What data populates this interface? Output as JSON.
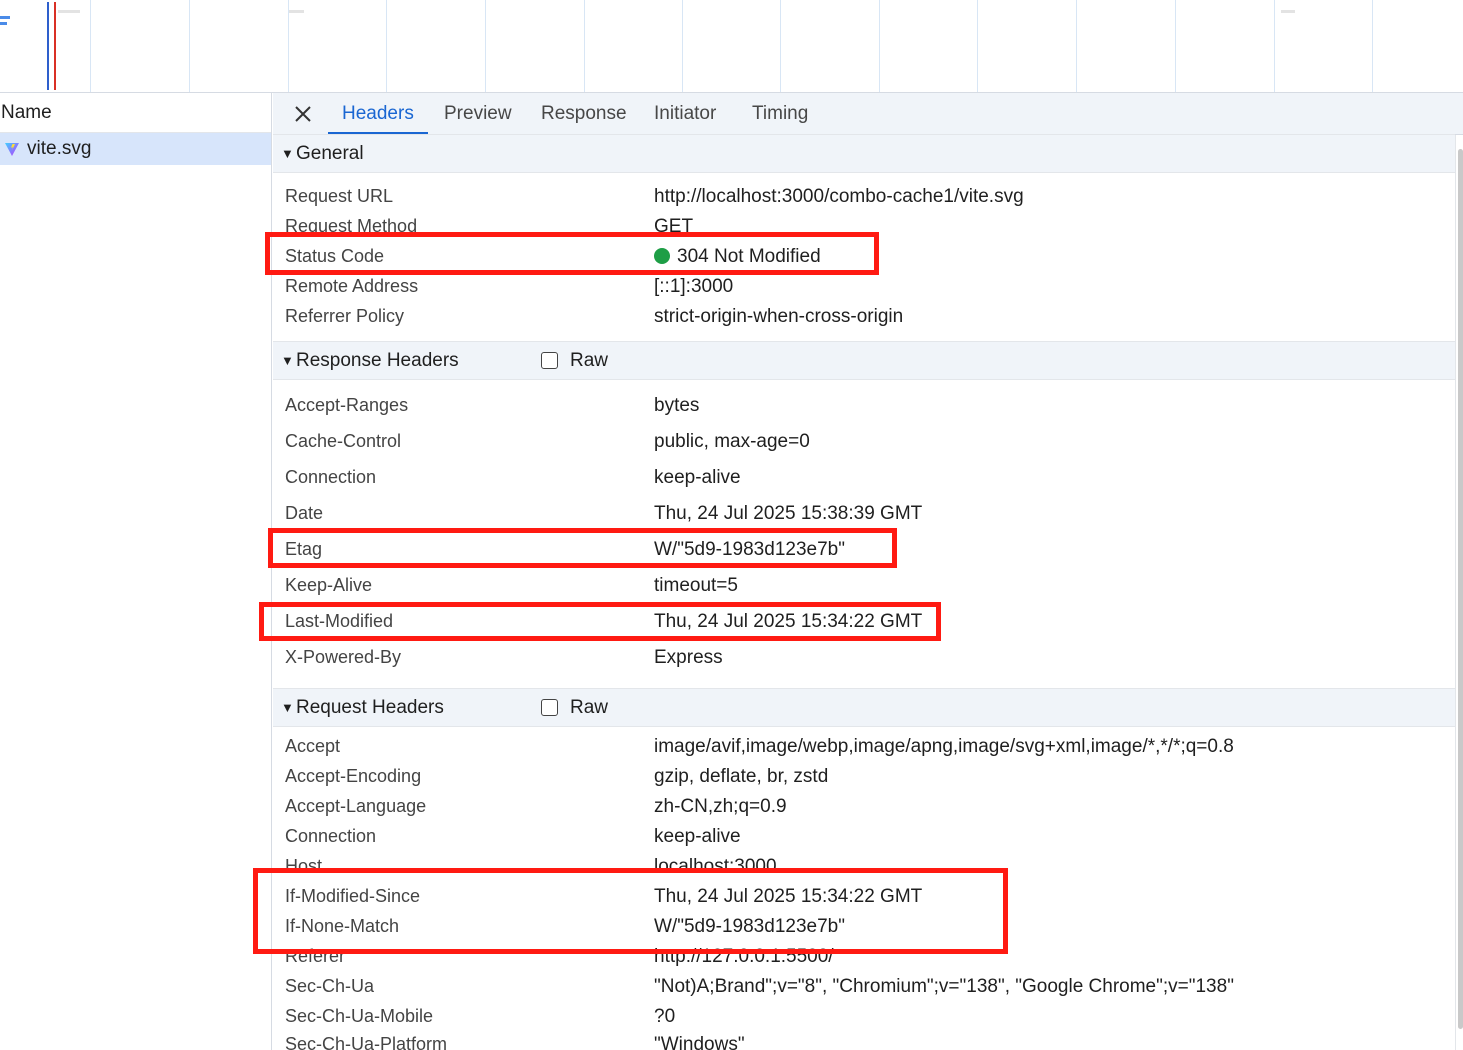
{
  "name_panel": {
    "header": "Name",
    "selected_file": "vite.svg"
  },
  "tabs": {
    "headers": "Headers",
    "preview": "Preview",
    "response": "Response",
    "initiator": "Initiator",
    "timing": "Timing"
  },
  "general": {
    "title": "General",
    "rows": [
      {
        "key": "Request URL",
        "value": "http://localhost:3000/combo-cache1/vite.svg"
      },
      {
        "key": "Request Method",
        "value": "GET"
      },
      {
        "key": "Status Code",
        "value": "304 Not Modified"
      },
      {
        "key": "Remote Address",
        "value": "[::1]:3000"
      },
      {
        "key": "Referrer Policy",
        "value": "strict-origin-when-cross-origin"
      }
    ]
  },
  "response_headers": {
    "title": "Response Headers",
    "raw_label": "Raw",
    "rows": [
      {
        "key": "Accept-Ranges",
        "value": "bytes"
      },
      {
        "key": "Cache-Control",
        "value": "public, max-age=0"
      },
      {
        "key": "Connection",
        "value": "keep-alive"
      },
      {
        "key": "Date",
        "value": "Thu, 24 Jul 2025 15:38:39 GMT"
      },
      {
        "key": "Etag",
        "value": "W/\"5d9-1983d123e7b\""
      },
      {
        "key": "Keep-Alive",
        "value": "timeout=5"
      },
      {
        "key": "Last-Modified",
        "value": "Thu, 24 Jul 2025 15:34:22 GMT"
      },
      {
        "key": "X-Powered-By",
        "value": "Express"
      }
    ]
  },
  "request_headers": {
    "title": "Request Headers",
    "raw_label": "Raw",
    "rows": [
      {
        "key": "Accept",
        "value": "image/avif,image/webp,image/apng,image/svg+xml,image/*,*/*;q=0.8"
      },
      {
        "key": "Accept-Encoding",
        "value": "gzip, deflate, br, zstd"
      },
      {
        "key": "Accept-Language",
        "value": "zh-CN,zh;q=0.9"
      },
      {
        "key": "Connection",
        "value": "keep-alive"
      },
      {
        "key": "Host",
        "value": "localhost:3000"
      },
      {
        "key": "If-Modified-Since",
        "value": "Thu, 24 Jul 2025 15:34:22 GMT"
      },
      {
        "key": "If-None-Match",
        "value": "W/\"5d9-1983d123e7b\""
      },
      {
        "key": "Referer",
        "value": "http://127.0.0.1:5500/"
      },
      {
        "key": "Sec-Ch-Ua",
        "value": "\"Not)A;Brand\";v=\"8\", \"Chromium\";v=\"138\", \"Google Chrome\";v=\"138\""
      },
      {
        "key": "Sec-Ch-Ua-Mobile",
        "value": "?0"
      },
      {
        "key": "Sec-Ch-Ua-Platform",
        "value": "\"Windows\""
      }
    ]
  },
  "colors": {
    "accent": "#1a66d2",
    "status_ok": "#1e9e46",
    "highlight": "#ff1a12",
    "selected_row": "#d7e5fb"
  }
}
